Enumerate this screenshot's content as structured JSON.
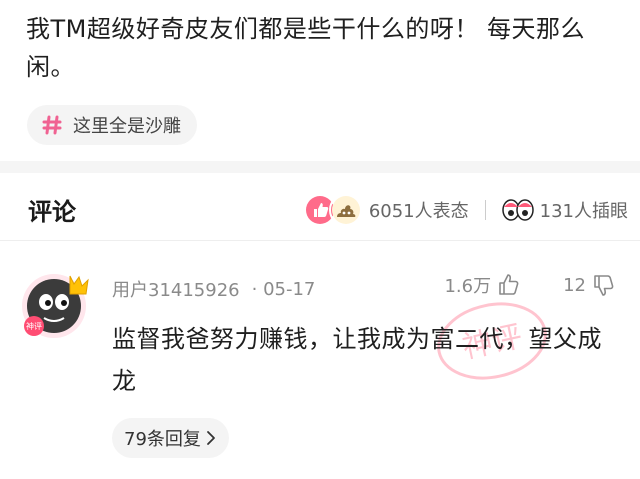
{
  "post": {
    "text": "我TM超级好奇皮友们都是些干什么的呀！   每天那么闲。",
    "topic": "这里全是沙雕"
  },
  "comments_section": {
    "title": "评论",
    "reaction_count": "6051人表态",
    "eye_count": "131人插眼"
  },
  "comment": {
    "username": "用户31415926",
    "date": "· 05-17",
    "likes": "1.6万",
    "dislikes": "12",
    "text": "监督我爸努力赚钱，让我成为富二代，望父成龙",
    "avatar_badge": "神评",
    "stamp_text": "神评",
    "replies": "79条回复"
  },
  "colors": {
    "accent": "#ff5a79",
    "hash": "#f06292",
    "text_primary": "#1f1f1f",
    "text_secondary": "#8a8a8a",
    "chip_bg": "#f4f4f4"
  }
}
